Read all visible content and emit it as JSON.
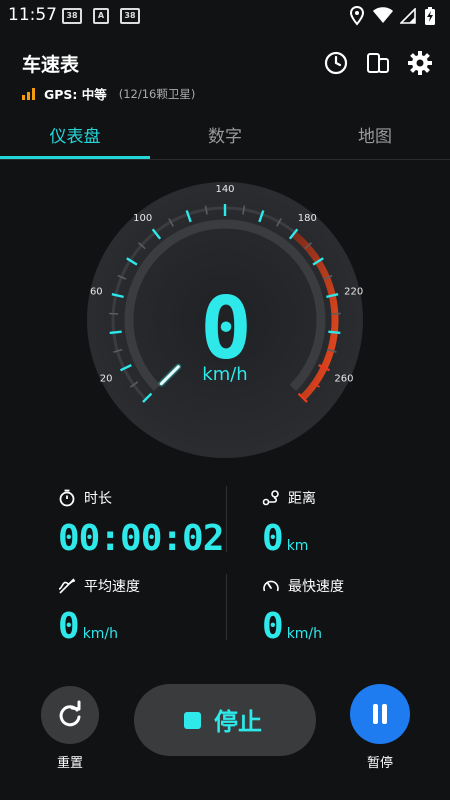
{
  "status_bar": {
    "time": "11:57",
    "notif_icons": [
      "38",
      "A",
      "38"
    ]
  },
  "header": {
    "title": "车速表",
    "gps_label": "GPS: 中等",
    "gps_satellites": "(12/16颗卫星)"
  },
  "tabs": [
    {
      "label": "仪表盘",
      "active": true
    },
    {
      "label": "数字",
      "active": false
    },
    {
      "label": "地图",
      "active": false
    }
  ],
  "speedometer": {
    "speed": "0",
    "unit": "km/h",
    "dial_max": 280,
    "tick_labels": [
      "20",
      "60",
      "100",
      "140",
      "180",
      "220",
      "260"
    ],
    "colors": {
      "accent": "#2ee8ea",
      "danger": "#e53a1e"
    }
  },
  "stats": {
    "duration": {
      "label": "时长",
      "value": "00:00:02"
    },
    "distance": {
      "label": "距离",
      "value": "0",
      "unit": "km"
    },
    "avg_speed": {
      "label": "平均速度",
      "value": "0",
      "unit": "km/h"
    },
    "max_speed": {
      "label": "最快速度",
      "value": "0",
      "unit": "km/h"
    }
  },
  "controls": {
    "reset_label": "重置",
    "stop_label": "停止",
    "pause_label": "暂停",
    "pause_color": "#1e7bf0"
  }
}
